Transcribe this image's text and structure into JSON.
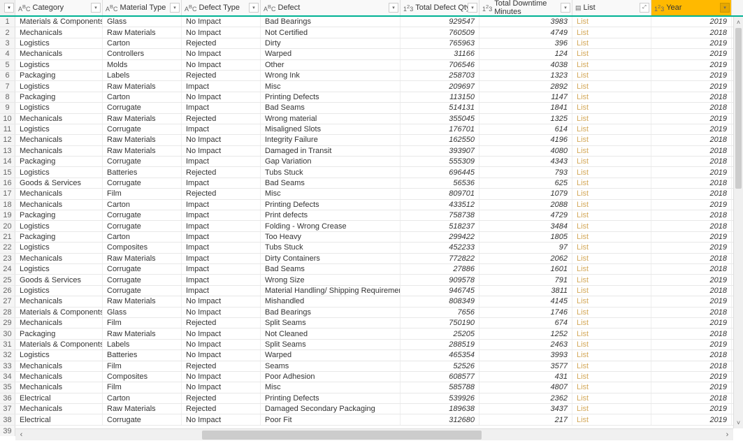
{
  "columns": {
    "category": {
      "label": "Category",
      "type": "ABC"
    },
    "material": {
      "label": "Material Type",
      "type": "ABC"
    },
    "defectType": {
      "label": "Defect Type",
      "type": "ABC"
    },
    "defect": {
      "label": "Defect",
      "type": "ABC"
    },
    "qty": {
      "label": "Total Defect Qty",
      "type": "123"
    },
    "downtime": {
      "label": "Total Downtime Minutes",
      "type": "123"
    },
    "list": {
      "label": "List",
      "type": "list"
    },
    "year": {
      "label": "Year",
      "type": "123"
    }
  },
  "listCellText": "List",
  "lastRowNum": "39",
  "rows": [
    {
      "n": 1,
      "category": "Materials & Components",
      "material": "Glass",
      "defectType": "No Impact",
      "defect": "Bad Bearings",
      "qty": 929547,
      "downtime": 3983,
      "year": 2019
    },
    {
      "n": 2,
      "category": "Mechanicals",
      "material": "Raw Materials",
      "defectType": "No Impact",
      "defect": "Not Certified",
      "qty": 760509,
      "downtime": 4749,
      "year": 2018
    },
    {
      "n": 3,
      "category": "Logistics",
      "material": "Carton",
      "defectType": "Rejected",
      "defect": "Dirty",
      "qty": 765963,
      "downtime": 396,
      "year": 2019
    },
    {
      "n": 4,
      "category": "Mechanicals",
      "material": "Controllers",
      "defectType": "No Impact",
      "defect": "Warped",
      "qty": 31166,
      "downtime": 124,
      "year": 2019
    },
    {
      "n": 5,
      "category": "Logistics",
      "material": "Molds",
      "defectType": "No Impact",
      "defect": "Other",
      "qty": 706546,
      "downtime": 4038,
      "year": 2019
    },
    {
      "n": 6,
      "category": "Packaging",
      "material": "Labels",
      "defectType": "Rejected",
      "defect": "Wrong Ink",
      "qty": 258703,
      "downtime": 1323,
      "year": 2019
    },
    {
      "n": 7,
      "category": "Logistics",
      "material": "Raw Materials",
      "defectType": "Impact",
      "defect": "Misc",
      "qty": 209697,
      "downtime": 2892,
      "year": 2019
    },
    {
      "n": 8,
      "category": "Packaging",
      "material": "Carton",
      "defectType": "No Impact",
      "defect": "Printing Defects",
      "qty": 113150,
      "downtime": 1147,
      "year": 2018
    },
    {
      "n": 9,
      "category": "Logistics",
      "material": "Corrugate",
      "defectType": "Impact",
      "defect": "Bad Seams",
      "qty": 514131,
      "downtime": 1841,
      "year": 2018
    },
    {
      "n": 10,
      "category": "Mechanicals",
      "material": "Raw Materials",
      "defectType": "Rejected",
      "defect": "Wrong material",
      "qty": 355045,
      "downtime": 1325,
      "year": 2019
    },
    {
      "n": 11,
      "category": "Logistics",
      "material": "Corrugate",
      "defectType": "Impact",
      "defect": "Misaligned Slots",
      "qty": 176701,
      "downtime": 614,
      "year": 2019
    },
    {
      "n": 12,
      "category": "Mechanicals",
      "material": "Raw Materials",
      "defectType": "No Impact",
      "defect": "Integrity Failure",
      "qty": 162550,
      "downtime": 4196,
      "year": 2018
    },
    {
      "n": 13,
      "category": "Mechanicals",
      "material": "Raw Materials",
      "defectType": "No Impact",
      "defect": "Damaged in Transit",
      "qty": 393907,
      "downtime": 4080,
      "year": 2018
    },
    {
      "n": 14,
      "category": "Packaging",
      "material": "Corrugate",
      "defectType": "Impact",
      "defect": "Gap Variation",
      "qty": 555309,
      "downtime": 4343,
      "year": 2018
    },
    {
      "n": 15,
      "category": "Logistics",
      "material": "Batteries",
      "defectType": "Rejected",
      "defect": "Tubs Stuck",
      "qty": 696445,
      "downtime": 793,
      "year": 2019
    },
    {
      "n": 16,
      "category": "Goods & Services",
      "material": "Corrugate",
      "defectType": "Impact",
      "defect": "Bad Seams",
      "qty": 56536,
      "downtime": 625,
      "year": 2018
    },
    {
      "n": 17,
      "category": "Mechanicals",
      "material": "Film",
      "defectType": "Rejected",
      "defect": "Misc",
      "qty": 809701,
      "downtime": 1079,
      "year": 2018
    },
    {
      "n": 18,
      "category": "Mechanicals",
      "material": "Carton",
      "defectType": "Impact",
      "defect": "Printing Defects",
      "qty": 433512,
      "downtime": 2088,
      "year": 2019
    },
    {
      "n": 19,
      "category": "Packaging",
      "material": "Corrugate",
      "defectType": "Impact",
      "defect": "Print defects",
      "qty": 758738,
      "downtime": 4729,
      "year": 2018
    },
    {
      "n": 20,
      "category": "Logistics",
      "material": "Corrugate",
      "defectType": "Impact",
      "defect": "Folding - Wrong Crease",
      "qty": 518237,
      "downtime": 3484,
      "year": 2018
    },
    {
      "n": 21,
      "category": "Packaging",
      "material": "Carton",
      "defectType": "Impact",
      "defect": "Too Heavy",
      "qty": 299422,
      "downtime": 1805,
      "year": 2019
    },
    {
      "n": 22,
      "category": "Logistics",
      "material": "Composites",
      "defectType": "Impact",
      "defect": "Tubs Stuck",
      "qty": 452233,
      "downtime": 97,
      "year": 2019
    },
    {
      "n": 23,
      "category": "Mechanicals",
      "material": "Raw Materials",
      "defectType": "Impact",
      "defect": "Dirty Containers",
      "qty": 772822,
      "downtime": 2062,
      "year": 2018
    },
    {
      "n": 24,
      "category": "Logistics",
      "material": "Corrugate",
      "defectType": "Impact",
      "defect": "Bad Seams",
      "qty": 27886,
      "downtime": 1601,
      "year": 2018
    },
    {
      "n": 25,
      "category": "Goods & Services",
      "material": "Corrugate",
      "defectType": "Impact",
      "defect": "Wrong  Size",
      "qty": 909578,
      "downtime": 791,
      "year": 2019
    },
    {
      "n": 26,
      "category": "Logistics",
      "material": "Corrugate",
      "defectType": "Impact",
      "defect": "Material Handling/ Shipping Requirements Error",
      "qty": 946745,
      "downtime": 3811,
      "year": 2018
    },
    {
      "n": 27,
      "category": "Mechanicals",
      "material": "Raw Materials",
      "defectType": "No Impact",
      "defect": "Mishandled",
      "qty": 808349,
      "downtime": 4145,
      "year": 2019
    },
    {
      "n": 28,
      "category": "Materials & Components",
      "material": "Glass",
      "defectType": "No Impact",
      "defect": "Bad Bearings",
      "qty": 7656,
      "downtime": 1746,
      "year": 2018
    },
    {
      "n": 29,
      "category": "Mechanicals",
      "material": "Film",
      "defectType": "Rejected",
      "defect": "Split Seams",
      "qty": 750190,
      "downtime": 674,
      "year": 2019
    },
    {
      "n": 30,
      "category": "Packaging",
      "material": "Raw Materials",
      "defectType": "No Impact",
      "defect": "Not Cleaned",
      "qty": 25205,
      "downtime": 1252,
      "year": 2018
    },
    {
      "n": 31,
      "category": "Materials & Components",
      "material": "Labels",
      "defectType": "No Impact",
      "defect": "Split Seams",
      "qty": 288519,
      "downtime": 2463,
      "year": 2019
    },
    {
      "n": 32,
      "category": "Logistics",
      "material": "Batteries",
      "defectType": "No Impact",
      "defect": "Warped",
      "qty": 465354,
      "downtime": 3993,
      "year": 2018
    },
    {
      "n": 33,
      "category": "Mechanicals",
      "material": "Film",
      "defectType": "Rejected",
      "defect": "Seams",
      "qty": 52526,
      "downtime": 3577,
      "year": 2018
    },
    {
      "n": 34,
      "category": "Mechanicals",
      "material": "Composites",
      "defectType": "No Impact",
      "defect": "Poor  Adhesion",
      "qty": 608577,
      "downtime": 431,
      "year": 2019
    },
    {
      "n": 35,
      "category": "Mechanicals",
      "material": "Film",
      "defectType": "No Impact",
      "defect": "Misc",
      "qty": 585788,
      "downtime": 4807,
      "year": 2019
    },
    {
      "n": 36,
      "category": "Electrical",
      "material": "Carton",
      "defectType": "Rejected",
      "defect": "Printing Defects",
      "qty": 539926,
      "downtime": 2362,
      "year": 2018
    },
    {
      "n": 37,
      "category": "Mechanicals",
      "material": "Raw Materials",
      "defectType": "Rejected",
      "defect": "Damaged Secondary Packaging",
      "qty": 189638,
      "downtime": 3437,
      "year": 2019
    },
    {
      "n": 38,
      "category": "Electrical",
      "material": "Corrugate",
      "defectType": "No Impact",
      "defect": "Poor Fit",
      "qty": 312680,
      "downtime": 217,
      "year": 2019
    }
  ]
}
